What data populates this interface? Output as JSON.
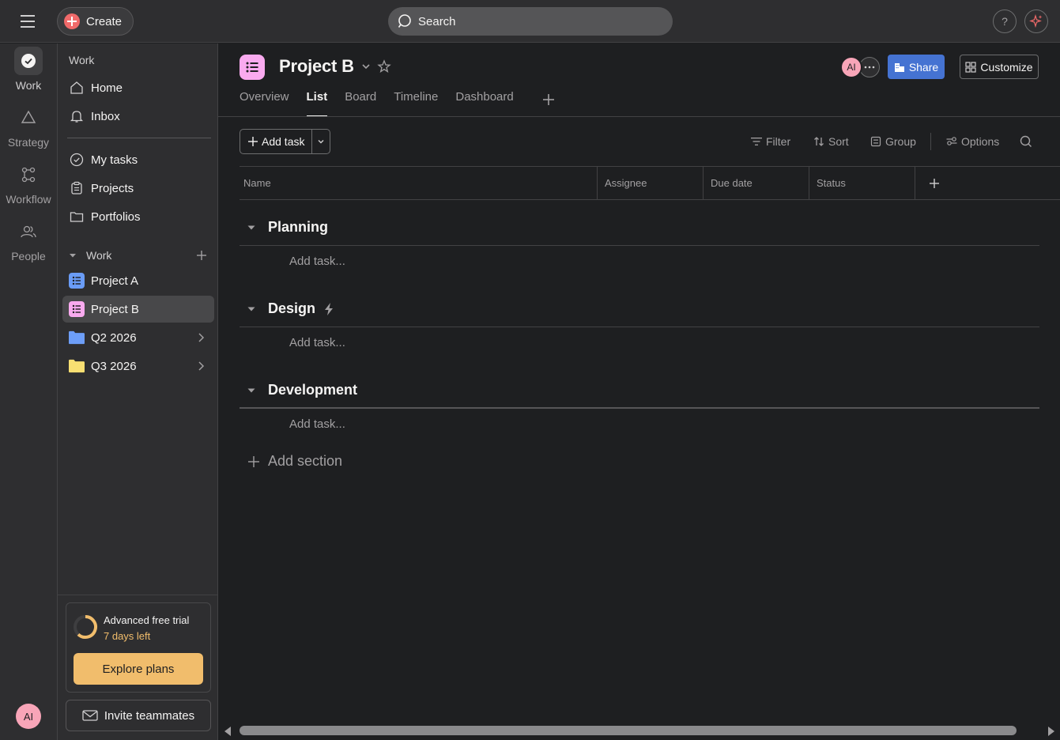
{
  "topbar": {
    "create_label": "Create",
    "search_placeholder": "Search",
    "help_label": "?"
  },
  "rail": {
    "items": [
      {
        "label": "Work",
        "icon": "check-circle-icon"
      },
      {
        "label": "Strategy",
        "icon": "triangle-icon"
      },
      {
        "label": "Workflow",
        "icon": "workflow-icon"
      },
      {
        "label": "People",
        "icon": "people-icon"
      }
    ],
    "avatar_initials": "AI"
  },
  "sidebar": {
    "heading": "Work",
    "nav": [
      {
        "label": "Home",
        "icon": "home-icon"
      },
      {
        "label": "Inbox",
        "icon": "bell-icon"
      }
    ],
    "nav2": [
      {
        "label": "My tasks",
        "icon": "check-circle-icon"
      },
      {
        "label": "Projects",
        "icon": "clipboard-icon"
      },
      {
        "label": "Portfolios",
        "icon": "folder-icon"
      }
    ],
    "section_label": "Work",
    "projects": [
      {
        "label": "Project A",
        "color": "#6a9cf6"
      },
      {
        "label": "Project B",
        "color": "#f9aaef"
      }
    ],
    "folders": [
      {
        "label": "Q2 2026",
        "color": "#6d9ef8"
      },
      {
        "label": "Q3 2026",
        "color": "#f8df72"
      }
    ],
    "trial": {
      "title": "Advanced free trial",
      "subtitle": "7 days left",
      "button": "Explore plans"
    },
    "invite_label": "Invite teammates"
  },
  "project": {
    "title": "Project B",
    "avatar_initials": "AI",
    "share_label": "Share",
    "customize_label": "Customize",
    "tabs": [
      {
        "label": "Overview",
        "active": false
      },
      {
        "label": "List",
        "active": true
      },
      {
        "label": "Board",
        "active": false
      },
      {
        "label": "Timeline",
        "active": false
      },
      {
        "label": "Dashboard",
        "active": false
      }
    ]
  },
  "toolbar": {
    "add_task_label": "Add task",
    "filter_label": "Filter",
    "sort_label": "Sort",
    "group_label": "Group",
    "options_label": "Options"
  },
  "table": {
    "columns": [
      "Name",
      "Assignee",
      "Due date",
      "Status"
    ],
    "sections": [
      {
        "title": "Planning",
        "add_task": "Add task..."
      },
      {
        "title": "Design",
        "add_task": "Add task..."
      },
      {
        "title": "Development",
        "add_task": "Add task..."
      }
    ],
    "add_section_label": "Add section"
  },
  "colors": {
    "accent_blue": "#4573d2",
    "create_red": "#f06a6a",
    "trial_orange": "#f1bd6c"
  }
}
